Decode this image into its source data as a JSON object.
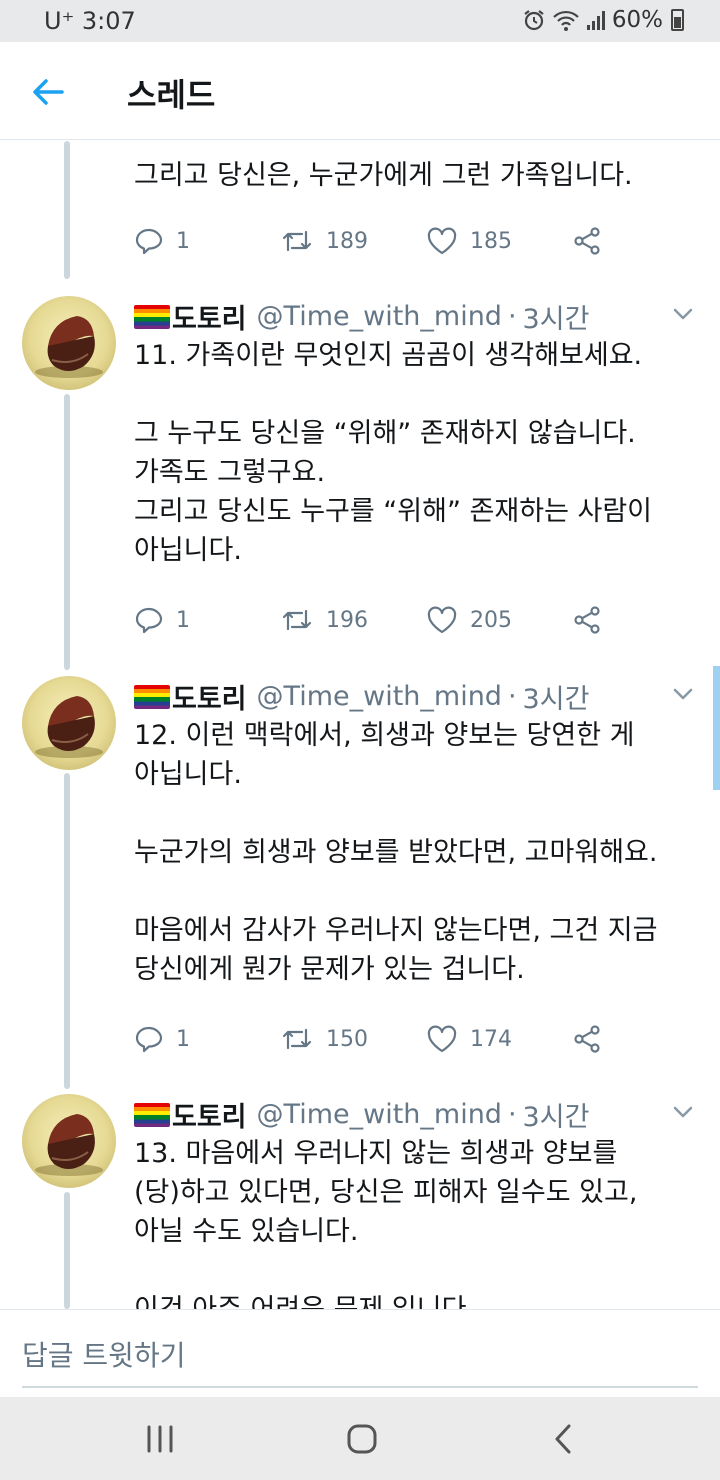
{
  "status_bar": {
    "carrier": "U⁺",
    "time": "3:07",
    "battery": "60%",
    "icons": [
      "alarm-icon",
      "wifi-icon",
      "signal-icon",
      "battery-icon"
    ]
  },
  "header": {
    "title": "스레드",
    "back_icon": "arrow-left-icon"
  },
  "colors": {
    "accent": "#1da1f2",
    "text": "#14171a",
    "muted": "#657786"
  },
  "tweets": [
    {
      "body": [
        "그리고 당신은, 누군가에게 그런 가족입니다."
      ],
      "replies": "1",
      "retweets": "189",
      "likes": "185"
    },
    {
      "author": "도토리",
      "handle": "@Time_with_mind",
      "separator": "·",
      "time": "3시간",
      "body": [
        "11. 가족이란 무엇인지 곰곰이 생각해보세요.",
        "",
        "그 누구도 당신을 “위해” 존재하지 않습니다.",
        "가족도 그렇구요.",
        "그리고 당신도 누구를 “위해” 존재하는 사람이",
        "아닙니다."
      ],
      "replies": "1",
      "retweets": "196",
      "likes": "205"
    },
    {
      "author": "도토리",
      "handle": "@Time_with_mind",
      "separator": "·",
      "time": "3시간",
      "body": [
        "12. 이런 맥락에서, 희생과 양보는 당연한 게",
        "아닙니다.",
        "",
        "누군가의 희생과 양보를 받았다면, 고마워해요.",
        "",
        "마음에서 감사가 우러나지 않는다면, 그건 지금",
        "당신에게 뭔가 문제가 있는 겁니다."
      ],
      "replies": "1",
      "retweets": "150",
      "likes": "174"
    },
    {
      "author": "도토리",
      "handle": "@Time_with_mind",
      "separator": "·",
      "time": "3시간",
      "body": [
        "13. 마음에서 우러나지 않는 희생과 양보를",
        "(당)하고 있다면, 당신은 피해자 일수도 있고,",
        "아닐 수도 있습니다.",
        "",
        "이건 아주 어려운 문제 입니다."
      ]
    }
  ],
  "reply": {
    "placeholder": "답글 트윗하기"
  }
}
